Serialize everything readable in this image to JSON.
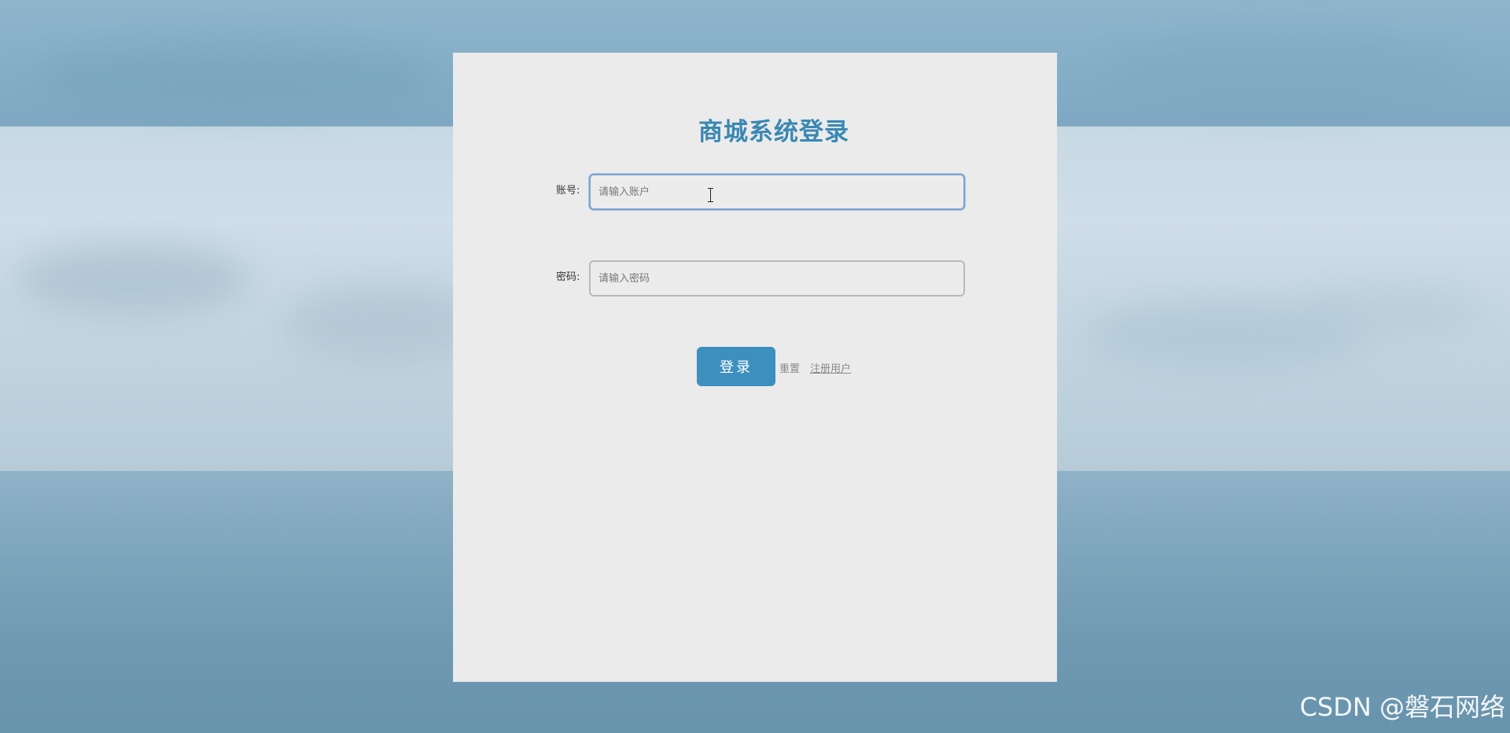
{
  "login": {
    "title": "商城系统登录",
    "account_label": "账号:",
    "account_placeholder": "请输入账户",
    "password_label": "密码:",
    "password_placeholder": "请输入密码",
    "submit_label": "登录",
    "reset_label": "重置",
    "register_label": "注册用户"
  },
  "watermark": "CSDN @磐石网络",
  "colors": {
    "accent": "#3d8fbe",
    "title": "#3a88b3",
    "panel": "#ebebeb"
  },
  "icons": {
    "text_cursor": "ibeam-cursor-icon"
  }
}
